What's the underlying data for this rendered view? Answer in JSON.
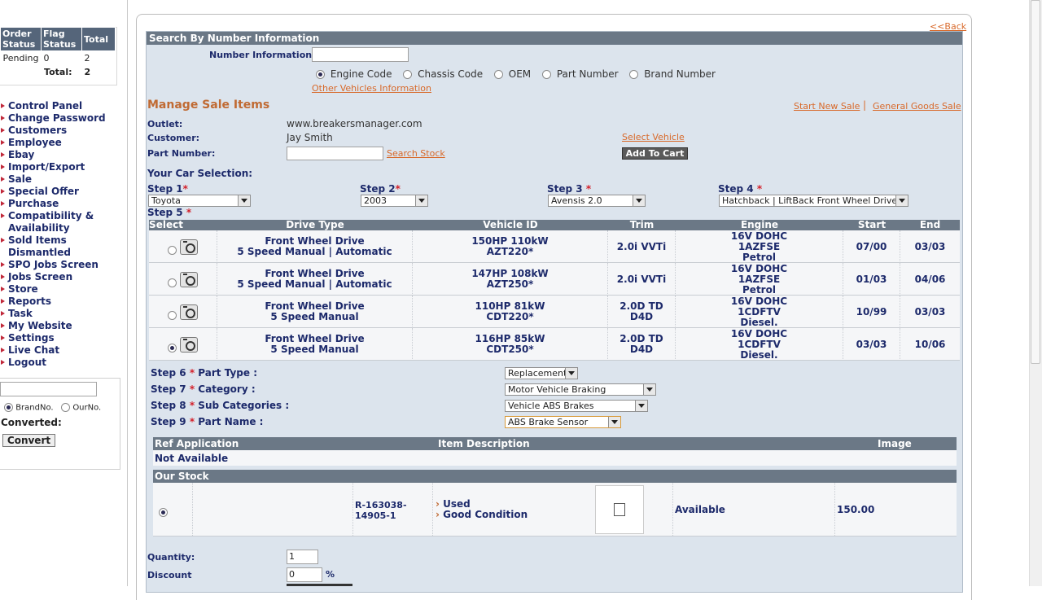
{
  "order_status": {
    "headers": [
      "Order Status",
      "Flag Status",
      "Total"
    ],
    "rows": [
      {
        "order": "Pending",
        "flag": "0",
        "total": "2"
      }
    ],
    "total_label": "Total:",
    "total_value": "2"
  },
  "menu": [
    "Control Panel",
    "Change Password",
    "Customers",
    "Employee",
    "Ebay",
    "Import/Export",
    "Sale",
    "Special Offer",
    "Purchase",
    "Compatibility & Availability",
    "Sold Items Dismantled",
    "SPO Jobs Screen",
    "Jobs Screen",
    "Store",
    "Reports",
    "Task",
    "My Website",
    "Settings",
    "Live Chat",
    "Logout"
  ],
  "converter": {
    "input_value": "",
    "radio_brand": "BrandNo.",
    "radio_our": "OurNo.",
    "converted_label": "Converted:",
    "convert_button": "Convert"
  },
  "back_link": "<<Back",
  "search": {
    "header": "Search By Number Information",
    "label": "Number Information:",
    "value": "",
    "options": [
      "Engine Code",
      "Chassis Code",
      "OEM",
      "Part Number",
      "Brand Number"
    ],
    "other_link": "Other Vehicles Information"
  },
  "manage": {
    "title": "Manage Sale Items",
    "start_new": "Start New Sale",
    "separator": "|",
    "general_goods": "General Goods Sale",
    "outlet_label": "Outlet:",
    "outlet_value": "www.breakersmanager.com",
    "customer_label": "Customer:",
    "customer_value": "Jay Smith",
    "part_label": "Part Number:",
    "part_value": "",
    "search_stock": "Search Stock",
    "select_vehicle": "Select Vehicle",
    "add_to_cart": "Add To Cart",
    "car_selection": "Your Car Selection:"
  },
  "steps": {
    "s1": "Step 1",
    "s1_val": "Toyota",
    "s2": "Step 2",
    "s2_val": "2003",
    "s3": "Step 3",
    "s3_val": "Avensis 2.0",
    "s4": "Step 4",
    "s4_val": "Hatchback | LiftBack Front Wheel Drive",
    "s5": "Step 5",
    "s6": "Step 6",
    "s6_label": "Part Type :",
    "s6_val": "Replacement",
    "s7": "Step 7",
    "s7_label": "Category :",
    "s7_val": "Motor Vehicle Braking",
    "s8": "Step 8",
    "s8_label": "Sub Categories :",
    "s8_val": "Vehicle ABS Brakes",
    "s9": "Step 9",
    "s9_label": "Part Name :",
    "s9_val": "ABS Brake Sensor",
    "req": "*"
  },
  "vehicles": {
    "headers": [
      "Select",
      "Drive Type",
      "Vehicle ID",
      "Trim",
      "Engine",
      "Start",
      "End"
    ],
    "rows": [
      {
        "drive1": "Front Wheel Drive",
        "drive2": "5 Speed Manual | Automatic",
        "id1": "150HP 110kW",
        "id2": "AZT220*",
        "trim": "2.0i VVTi",
        "eng1": "16V DOHC",
        "eng2": "1AZFSE",
        "eng3": "Petrol",
        "start": "07/00",
        "end": "03/03"
      },
      {
        "drive1": "Front Wheel Drive",
        "drive2": "5 Speed Manual | Automatic",
        "id1": "147HP 108kW",
        "id2": "AZT250*",
        "trim": "2.0i VVTi",
        "eng1": "16V DOHC",
        "eng2": "1AZFSE",
        "eng3": "Petrol",
        "start": "01/03",
        "end": "04/06"
      },
      {
        "drive1": "Front Wheel Drive",
        "drive2": "5 Speed Manual",
        "id1": "110HP 81kW",
        "id2": "CDT220*",
        "trim": "2.0D TD D4D",
        "eng1": "16V DOHC",
        "eng2": "1CDFTV",
        "eng3": "Diesel.",
        "start": "10/99",
        "end": "03/03"
      },
      {
        "drive1": "Front Wheel Drive",
        "drive2": "5 Speed Manual",
        "id1": "116HP 85kW",
        "id2": "CDT250*",
        "trim": "2.0D TD D4D",
        "eng1": "16V DOHC",
        "eng2": "1CDFTV",
        "eng3": "Diesel.",
        "start": "03/03",
        "end": "10/06"
      }
    ]
  },
  "ref": {
    "headers": [
      "Ref Application",
      "Item Description",
      "Image"
    ],
    "not_available": "Not Available"
  },
  "stock": {
    "header": "Our Stock",
    "ref1": "R-163038-",
    "ref2": "14905-1",
    "cond1": "Used",
    "cond2": "Good Condition",
    "status": "Available",
    "price": "150.00"
  },
  "bottom": {
    "qty_label": "Quantity:",
    "qty_value": "1",
    "disc_label": "Discount",
    "disc_value": "0",
    "pct": "%"
  }
}
